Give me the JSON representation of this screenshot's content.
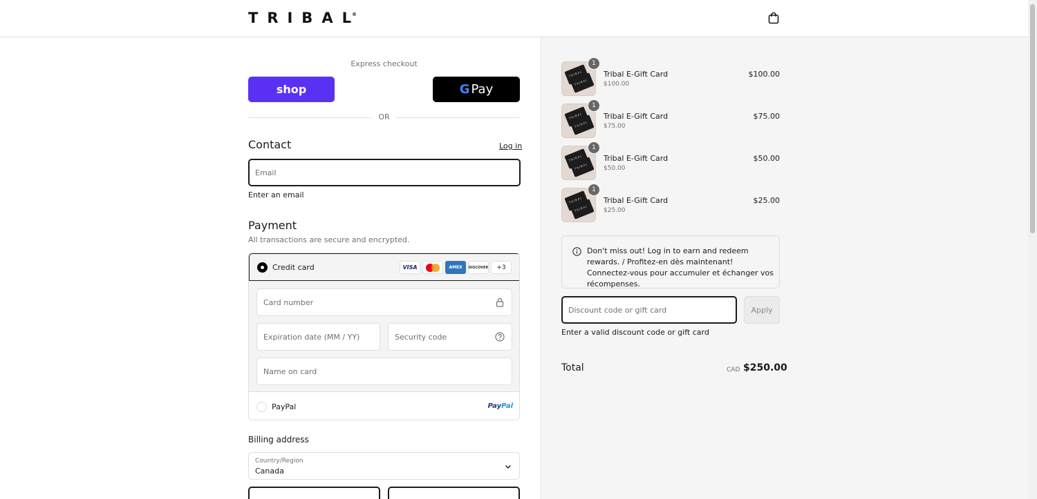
{
  "header": {
    "logo": "TRIBAL",
    "logo_mark": "®",
    "cart_icon": "shopping-bag-icon"
  },
  "express": {
    "label": "Express checkout",
    "shop_label": "shop",
    "gpay_g": "G",
    "gpay_label": "Pay",
    "or_label": "OR"
  },
  "contact": {
    "heading": "Contact",
    "login_link": "Log in",
    "email_placeholder": "Email",
    "email_error": "Enter an email"
  },
  "payment": {
    "heading": "Payment",
    "subtitle": "All transactions are secure and encrypted.",
    "credit_card_label": "Credit card",
    "card_brands": [
      "VISA",
      "mastercard",
      "AMEX",
      "DISCOVER"
    ],
    "more_cards": "+3",
    "card_number_placeholder": "Card number",
    "expiry_placeholder": "Expiration date (MM / YY)",
    "security_placeholder": "Security code",
    "name_placeholder": "Name on card",
    "paypal_label": "PayPal",
    "paypal_logo_a": "Pay",
    "paypal_logo_b": "Pal"
  },
  "billing": {
    "heading": "Billing address",
    "country_caption": "Country/Region",
    "country_value": "Canada"
  },
  "order": {
    "items": [
      {
        "qty": "1",
        "name": "Tribal E-Gift Card",
        "variant": "$100.00",
        "price": "$100.00"
      },
      {
        "qty": "1",
        "name": "Tribal E-Gift Card",
        "variant": "$75.00",
        "price": "$75.00"
      },
      {
        "qty": "1",
        "name": "Tribal E-Gift Card",
        "variant": "$50.00",
        "price": "$50.00"
      },
      {
        "qty": "1",
        "name": "Tribal E-Gift Card",
        "variant": "$25.00",
        "price": "$25.00"
      }
    ],
    "notice": "Don't miss out! Log in to earn and redeem rewards. / Profitez-en dès maintenant! Connectez-vous pour accumuler et échanger vos récompenses.",
    "discount_placeholder": "Discount code or gift card",
    "apply_label": "Apply",
    "discount_error": "Enter a valid discount code or gift card",
    "total_label": "Total",
    "total_currency": "CAD",
    "total_amount": "$250.00"
  },
  "colors": {
    "shop_purple": "#5a31f4",
    "accent_black": "#000000",
    "summary_bg": "#f5f5f5"
  }
}
